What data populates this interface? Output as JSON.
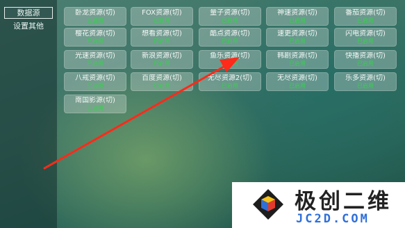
{
  "sidebar": {
    "items": [
      {
        "label": "数据源"
      },
      {
        "label": "设置其他"
      }
    ]
  },
  "sources": [
    {
      "name": "卧龙资源(切)",
      "status": "已启用"
    },
    {
      "name": "FOX资源(切)",
      "status": "已启用"
    },
    {
      "name": "量子资源(切)",
      "status": "已启用"
    },
    {
      "name": "神速资源(切)",
      "status": "已启用"
    },
    {
      "name": "番茄资源(切)",
      "status": "已启用"
    },
    {
      "name": "樱花资源(切)",
      "status": "已启用"
    },
    {
      "name": "想看资源(切)",
      "status": "已启用"
    },
    {
      "name": "酷点资源(切)",
      "status": "已启用"
    },
    {
      "name": "速更资源(切)",
      "status": "已启用"
    },
    {
      "name": "闪电资源(切)",
      "status": "已启用"
    },
    {
      "name": "光速资源(切)",
      "status": "已启用"
    },
    {
      "name": "新浪资源(切)",
      "status": "已启用"
    },
    {
      "name": "鱼乐资源(切)",
      "status": "已启用"
    },
    {
      "name": "韩剧资源(切)",
      "status": "已启用"
    },
    {
      "name": "快播资源(切)",
      "status": "已启用"
    },
    {
      "name": "八戒资源(切)",
      "status": "已启用"
    },
    {
      "name": "百度资源(切)",
      "status": "已启用"
    },
    {
      "name": "无尽资源2(切)",
      "status": "已启用"
    },
    {
      "name": "无尽资源(切)",
      "status": "已启用"
    },
    {
      "name": "乐多资源(切)",
      "status": "已启用"
    },
    {
      "name": "南国影源(切)",
      "status": "已启用"
    }
  ],
  "watermark": {
    "title": "极创二维",
    "subtitle": "JC2D.COM"
  },
  "colors": {
    "status_green": "#33d34a",
    "arrow_red": "#ff2a1a"
  },
  "icons": {
    "arrow": "red-arrow-icon",
    "logo": "cube-logo-icon"
  }
}
